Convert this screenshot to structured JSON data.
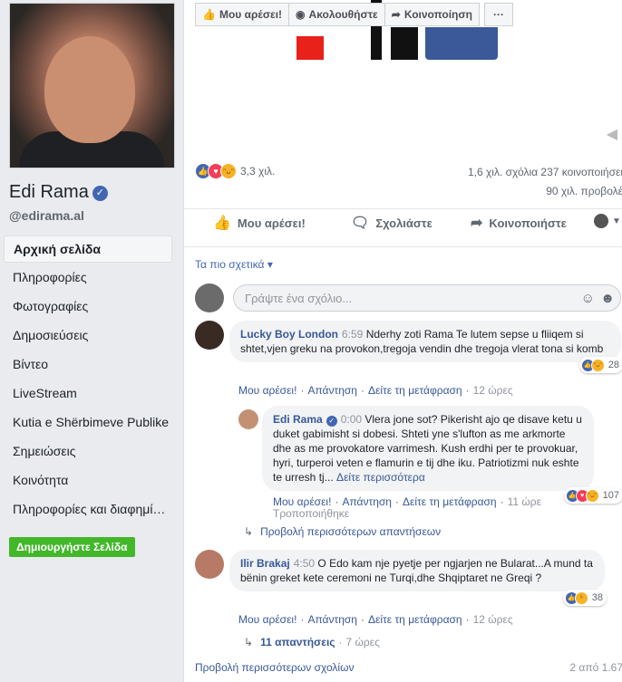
{
  "profile": {
    "name": "Edi Rama",
    "verified_mark": "✓",
    "handle": "@edirama.al"
  },
  "nav": {
    "items": [
      {
        "label": "Αρχική σελίδα",
        "active": true
      },
      {
        "label": "Πληροφορίες"
      },
      {
        "label": "Φωτογραφίες"
      },
      {
        "label": "Δημοσιεύσεις"
      },
      {
        "label": "Βίντεο"
      },
      {
        "label": "LiveStream"
      },
      {
        "label": "Kutia e Shërbimeve Publike"
      },
      {
        "label": "Σημειώσεις"
      },
      {
        "label": "Κοινότητα"
      },
      {
        "label": "Πληροφορίες και διαφημί…"
      }
    ],
    "create_page_label": "Δημιουργήστε Σελίδα"
  },
  "actionbar": {
    "like": "Μου αρέσει!",
    "follow": "Ακολουθήστε",
    "share": "Κοινοποίηση",
    "more": "···"
  },
  "stats": {
    "reactions": "3,3 χιλ.",
    "comments_shares": "1,6 χιλ. σχόλια   237 κοινοποιήσει",
    "views": "90 χιλ. προβολέ"
  },
  "post_actions": {
    "like": "Μου αρέσει!",
    "comment": "Σχολιάστε",
    "share": "Κοινοποιήστε"
  },
  "comments_section": {
    "sort_label": "Τα πιο σχετικά",
    "sort_icon": "▾",
    "input_placeholder": "Γράψτε ένα σχόλιο...",
    "more_comments": "Προβολή περισσότερων σχολίων",
    "pagination": "2 από 1.67"
  },
  "meta_labels": {
    "like": "Μου αρέσει!",
    "reply": "Απάντηση",
    "translate": "Δείτε τη μετάφραση",
    "see_more": "Δείτε περισσότερα",
    "edited": "Τροποποιήθηκε",
    "more_replies": "Προβολή περισσότερων απαντήσεων"
  },
  "comments": [
    {
      "author": "Lucky Boy London",
      "time": "6:59",
      "text": "Nderhy zoti Rama Te lutem sepse u fliiqem si shtet,vjen greku na provokon,tregoja vendin dhe tregoja vlerat tona si komb",
      "age": "12 ώρες",
      "reaction_count": "28"
    },
    {
      "author": "Edi Rama",
      "time": "0:00",
      "text": "Vlera jone sot? Pikerisht ajo qe disave ketu u duket gabimisht si dobesi. Shteti yne s'lufton as me arkmorte dhe as me provokatore varrimesh. Kush erdhi per te provokuar, hyri, turperoi veten e flamurin e tij dhe iku. Patriotizmi nuk eshte te urresh tj...",
      "age": "11 ώρε",
      "reaction_count": "107"
    },
    {
      "author": "Ilir Brakaj",
      "time": "4:50",
      "text": "O Edo kam nje pyetje per ngjarjen ne Bularat...A mund ta bënin greket kete ceremoni ne Turqi,dhe Shqiptaret ne Greqi ?",
      "age": "12 ώρες",
      "reaction_count": "38",
      "replies": "11 απαντήσεις",
      "replies_age": "7 ώρες"
    }
  ]
}
